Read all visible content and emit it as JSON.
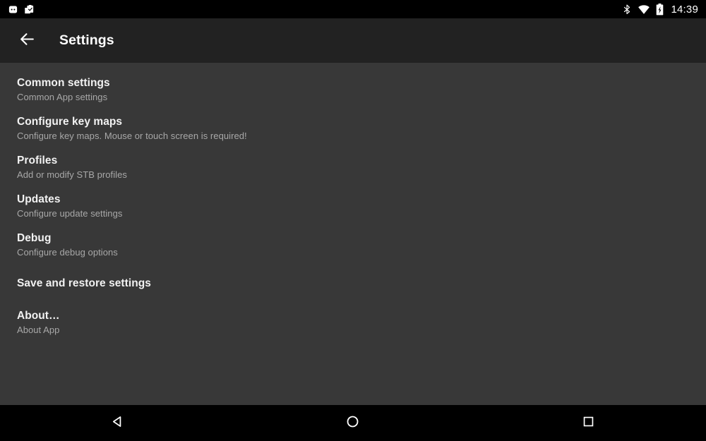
{
  "status_bar": {
    "left_icons": [
      {
        "name": "app-notification-icon",
        "label": "App notification"
      },
      {
        "name": "clipboard-check-icon",
        "label": "Clipboard task"
      }
    ],
    "right_icons": [
      {
        "name": "bluetooth-icon",
        "label": "Bluetooth"
      },
      {
        "name": "wifi-icon",
        "label": "Wi-Fi"
      },
      {
        "name": "battery-charging-icon",
        "label": "Battery charging"
      }
    ],
    "clock": "14:39",
    "background_color": "#000000",
    "icon_color": "#ffffff"
  },
  "toolbar": {
    "back_label": "Back",
    "title": "Settings",
    "background_color": "#222222",
    "title_color": "#ffffff"
  },
  "content": {
    "background_color": "#383838",
    "title_color": "#f2f2f2",
    "summary_color": "#a8a8a8",
    "items": [
      {
        "title": "Common settings",
        "summary": "Common App settings"
      },
      {
        "title": "Configure key maps",
        "summary": "Configure key maps. Mouse or touch screen is required!"
      },
      {
        "title": "Profiles",
        "summary": "Add or modify STB profiles"
      },
      {
        "title": "Updates",
        "summary": "Configure update settings"
      },
      {
        "title": "Debug",
        "summary": "Configure debug options"
      },
      {
        "title": "Save and restore settings",
        "summary": ""
      },
      {
        "title": "About…",
        "summary": "About App"
      }
    ]
  },
  "nav_bar": {
    "background_color": "#000000",
    "buttons": [
      {
        "name": "nav-back-icon",
        "label": "Back"
      },
      {
        "name": "nav-home-icon",
        "label": "Home"
      },
      {
        "name": "nav-recents-icon",
        "label": "Recents"
      }
    ]
  }
}
